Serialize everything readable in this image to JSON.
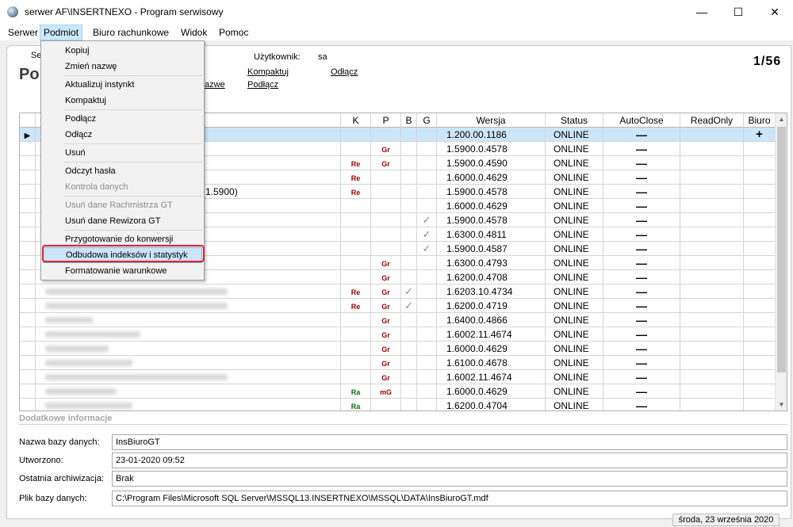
{
  "window": {
    "title": "serwer AF\\INSERTNEXO - Program serwisowy",
    "min_glyph": "—",
    "max_glyph": "☐",
    "close_glyph": "✕"
  },
  "menubar": {
    "items": [
      "Serwer",
      "Podmiot",
      "Biuro rachunkowe",
      "Widok",
      "Pomoc"
    ]
  },
  "page": {
    "tab_fragment": "Se",
    "title_fragment": "Po",
    "user_label": "Użytkownik:",
    "user_value": "sa",
    "links": [
      "Kompaktuj",
      "Odłącz",
      "Podłącz",
      "azwe"
    ],
    "counter": "1/56"
  },
  "dropdown": {
    "items": [
      {
        "label": "Kopiuj"
      },
      {
        "label": "Zmień nazwę"
      },
      {
        "label": "Aktualizuj instynkt"
      },
      {
        "label": "Kompaktuj"
      },
      {
        "label": "Podłącz"
      },
      {
        "label": "Odłącz"
      },
      {
        "label": "Usuń"
      },
      {
        "label": "Odczyt hasła"
      },
      {
        "label": "Kontrola danych"
      },
      {
        "label": "Usuń dane Rachmistrza GT"
      },
      {
        "label": "Usuń dane Rewizora GT"
      },
      {
        "label": "Przygotowanie do konwersji"
      },
      {
        "label": "Odbudowa indeksów i statystyk"
      },
      {
        "label": "Formatowanie warunkowe"
      }
    ]
  },
  "grid": {
    "columns": [
      "K",
      "P",
      "B",
      "G",
      "Wersja",
      "Status",
      "AutoClose",
      "ReadOnly",
      "Biuro"
    ],
    "visible_name_fragment": "1.5900)",
    "rows": [
      {
        "k": "",
        "p": "",
        "b": "",
        "g": "",
        "version": "1.200.00.1186",
        "status": "ONLINE",
        "autoclose": "—",
        "readonly": "",
        "biuro": "+",
        "selected": true
      },
      {
        "k": "",
        "p": "Gr",
        "b": "",
        "g": "",
        "version": "1.5900.0.4578",
        "status": "ONLINE",
        "autoclose": "—",
        "readonly": "",
        "biuro": ""
      },
      {
        "k": "Re",
        "p": "Gr",
        "b": "",
        "g": "",
        "version": "1.5900.0.4590",
        "status": "ONLINE",
        "autoclose": "—",
        "readonly": "",
        "biuro": ""
      },
      {
        "k": "Re",
        "p": "",
        "b": "",
        "g": "",
        "version": "1.6000.0.4629",
        "status": "ONLINE",
        "autoclose": "—",
        "readonly": "",
        "biuro": ""
      },
      {
        "k": "Re",
        "p": "",
        "b": "",
        "g": "",
        "version": "1.5900.0.4578",
        "status": "ONLINE",
        "autoclose": "—",
        "readonly": "",
        "biuro": ""
      },
      {
        "k": "",
        "p": "",
        "b": "",
        "g": "",
        "version": "1.6000.0.4629",
        "status": "ONLINE",
        "autoclose": "—",
        "readonly": "",
        "biuro": ""
      },
      {
        "k": "",
        "p": "",
        "b": "",
        "g": "✓",
        "version": "1.5900.0.4578",
        "status": "ONLINE",
        "autoclose": "—",
        "readonly": "",
        "biuro": ""
      },
      {
        "k": "",
        "p": "",
        "b": "",
        "g": "✓",
        "version": "1.6300.0.4811",
        "status": "ONLINE",
        "autoclose": "—",
        "readonly": "",
        "biuro": ""
      },
      {
        "k": "",
        "p": "",
        "b": "",
        "g": "✓",
        "version": "1.5900.0.4587",
        "status": "ONLINE",
        "autoclose": "—",
        "readonly": "",
        "biuro": ""
      },
      {
        "k": "",
        "p": "Gr",
        "b": "",
        "g": "",
        "version": "1.6300.0.4793",
        "status": "ONLINE",
        "autoclose": "—",
        "readonly": "",
        "biuro": ""
      },
      {
        "k": "",
        "p": "Gr",
        "b": "",
        "g": "",
        "version": "1.6200.0.4708",
        "status": "ONLINE",
        "autoclose": "—",
        "readonly": "",
        "biuro": ""
      },
      {
        "k": "Re",
        "p": "Gr",
        "b": "✓",
        "g": "",
        "version": "1.6203.10.4734",
        "status": "ONLINE",
        "autoclose": "—",
        "readonly": "",
        "biuro": ""
      },
      {
        "k": "Re",
        "p": "Gr",
        "b": "✓",
        "g": "",
        "version": "1.6200.0.4719",
        "status": "ONLINE",
        "autoclose": "—",
        "readonly": "",
        "biuro": ""
      },
      {
        "k": "",
        "p": "Gr",
        "b": "",
        "g": "",
        "version": "1.6400.0.4866",
        "status": "ONLINE",
        "autoclose": "—",
        "readonly": "",
        "biuro": ""
      },
      {
        "k": "",
        "p": "Gr",
        "b": "",
        "g": "",
        "version": "1.6002.11.4674",
        "status": "ONLINE",
        "autoclose": "—",
        "readonly": "",
        "biuro": ""
      },
      {
        "k": "",
        "p": "Gr",
        "b": "",
        "g": "",
        "version": "1.6000.0.4629",
        "status": "ONLINE",
        "autoclose": "—",
        "readonly": "",
        "biuro": ""
      },
      {
        "k": "",
        "p": "Gr",
        "b": "",
        "g": "",
        "version": "1.6100.0.4678",
        "status": "ONLINE",
        "autoclose": "—",
        "readonly": "",
        "biuro": ""
      },
      {
        "k": "",
        "p": "Gr",
        "b": "",
        "g": "",
        "version": "1.6002.11.4674",
        "status": "ONLINE",
        "autoclose": "—",
        "readonly": "",
        "biuro": ""
      },
      {
        "k": "Ra",
        "p": "mG",
        "b": "",
        "g": "",
        "version": "1.6000.0.4629",
        "status": "ONLINE",
        "autoclose": "—",
        "readonly": "",
        "biuro": ""
      },
      {
        "k": "Ra",
        "p": "",
        "b": "",
        "g": "",
        "version": "1.6200.0.4704",
        "status": "ONLINE",
        "autoclose": "—",
        "readonly": "",
        "biuro": ""
      }
    ]
  },
  "info": {
    "header": "Dodatkowe informacje",
    "fields": [
      {
        "label": "Nazwa bazy danych:",
        "value": "InsBiuroGT"
      },
      {
        "label": "Utworzono:",
        "value": "23-01-2020 09:52"
      },
      {
        "label": "Ostatnia archiwizacja:",
        "value": "Brak"
      },
      {
        "label": "Plik bazy danych:",
        "value": "C:\\Program Files\\Microsoft SQL Server\\MSSQL13.INSERTNEXO\\MSSQL\\DATA\\InsBiuroGT.mdf"
      }
    ]
  },
  "statusbar": {
    "date": "środa, 23 września 2020"
  }
}
